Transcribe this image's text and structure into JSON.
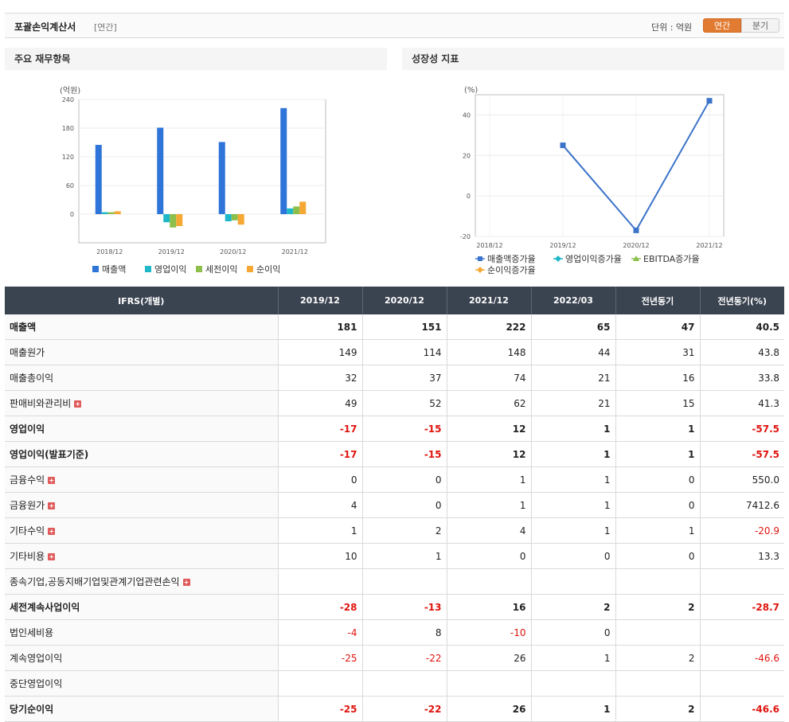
{
  "header": {
    "title": "포괄손익계산서",
    "period_type": "[연간]",
    "unit_label": "단위 : 억원",
    "toggle_annual": "연간",
    "toggle_quarter": "분기"
  },
  "panels": {
    "left_title": "주요 재무항목",
    "right_title": "성장성 지표"
  },
  "chart_data": [
    {
      "type": "bar",
      "ylabel": "(억원)",
      "categories": [
        "2018/12",
        "2019/12",
        "2020/12",
        "2021/12"
      ],
      "yticks": [
        "240",
        "180",
        "120",
        "60",
        "0"
      ],
      "ylim": [
        -60,
        240
      ],
      "grid": true,
      "legend_position": "bottom",
      "series": [
        {
          "name": "매출액",
          "color": "#2f74d8",
          "values": [
            145,
            181,
            151,
            222
          ]
        },
        {
          "name": "영업이익",
          "color": "#1fb8c9",
          "values": [
            4,
            -17,
            -15,
            12
          ]
        },
        {
          "name": "세전이익",
          "color": "#8cbf4b",
          "values": [
            4,
            -28,
            -13,
            16
          ]
        },
        {
          "name": "순이익",
          "color": "#f5a833",
          "values": [
            6,
            -25,
            -22,
            26
          ]
        }
      ]
    },
    {
      "type": "line",
      "ylabel": "(%)",
      "categories": [
        "2018/12",
        "2019/12",
        "2020/12",
        "2021/12"
      ],
      "yticks": [
        "40",
        "20",
        "0",
        "-20"
      ],
      "ylim": [
        -20,
        50
      ],
      "grid": true,
      "legend_position": "bottom",
      "series": [
        {
          "name": "매출액증가율",
          "color": "#3b74c9",
          "values": [
            null,
            25,
            -17,
            47
          ]
        }
      ],
      "legend": [
        {
          "name": "매출액증가율",
          "color": "#3b74c9",
          "marker": "square"
        },
        {
          "name": "영업이익증가율",
          "color": "#1fb8c9",
          "marker": "diamond"
        },
        {
          "name": "EBITDA증가율",
          "color": "#8cbf4b",
          "marker": "triangle"
        },
        {
          "name": "순이익증가율",
          "color": "#f5a833",
          "marker": "diamond"
        }
      ]
    }
  ],
  "table": {
    "columns": [
      "IFRS(개별)",
      "2019/12",
      "2020/12",
      "2021/12",
      "2022/03",
      "전년동기",
      "전년동기(%)"
    ],
    "rows": [
      {
        "label": "매출액",
        "bold": true,
        "plus": false,
        "cells": [
          "181",
          "151",
          "222",
          "65",
          "47",
          "40.5"
        ],
        "neg": [
          false,
          false,
          false,
          false,
          false,
          false
        ]
      },
      {
        "label": "매출원가",
        "bold": false,
        "plus": false,
        "cells": [
          "149",
          "114",
          "148",
          "44",
          "31",
          "43.8"
        ],
        "neg": [
          false,
          false,
          false,
          false,
          false,
          false
        ]
      },
      {
        "label": "매출총이익",
        "bold": false,
        "plus": false,
        "cells": [
          "32",
          "37",
          "74",
          "21",
          "16",
          "33.8"
        ],
        "neg": [
          false,
          false,
          false,
          false,
          false,
          false
        ]
      },
      {
        "label": "판매비와관리비",
        "bold": false,
        "plus": true,
        "cells": [
          "49",
          "52",
          "62",
          "21",
          "15",
          "41.3"
        ],
        "neg": [
          false,
          false,
          false,
          false,
          false,
          false
        ]
      },
      {
        "label": "영업이익",
        "bold": true,
        "plus": false,
        "cells": [
          "-17",
          "-15",
          "12",
          "1",
          "1",
          "-57.5"
        ],
        "neg": [
          true,
          true,
          false,
          false,
          false,
          true
        ]
      },
      {
        "label": "영업이익(발표기준)",
        "bold": true,
        "plus": false,
        "cells": [
          "-17",
          "-15",
          "12",
          "1",
          "1",
          "-57.5"
        ],
        "neg": [
          true,
          true,
          false,
          false,
          false,
          true
        ]
      },
      {
        "label": "금융수익",
        "bold": false,
        "plus": true,
        "cells": [
          "0",
          "0",
          "1",
          "1",
          "0",
          "550.0"
        ],
        "neg": [
          false,
          false,
          false,
          false,
          false,
          false
        ]
      },
      {
        "label": "금융원가",
        "bold": false,
        "plus": true,
        "cells": [
          "4",
          "0",
          "1",
          "1",
          "0",
          "7412.6"
        ],
        "neg": [
          false,
          false,
          false,
          false,
          false,
          false
        ]
      },
      {
        "label": "기타수익",
        "bold": false,
        "plus": true,
        "cells": [
          "1",
          "2",
          "4",
          "1",
          "1",
          "-20.9"
        ],
        "neg": [
          false,
          false,
          false,
          false,
          false,
          true
        ]
      },
      {
        "label": "기타비용",
        "bold": false,
        "plus": true,
        "cells": [
          "10",
          "1",
          "0",
          "0",
          "0",
          "13.3"
        ],
        "neg": [
          false,
          false,
          false,
          false,
          false,
          false
        ]
      },
      {
        "label": "종속기업,공동지배기업및관계기업관련손익",
        "bold": false,
        "plus": true,
        "cells": [
          "",
          "",
          "",
          "",
          "",
          ""
        ],
        "neg": [
          false,
          false,
          false,
          false,
          false,
          false
        ]
      },
      {
        "label": "세전계속사업이익",
        "bold": true,
        "plus": false,
        "cells": [
          "-28",
          "-13",
          "16",
          "2",
          "2",
          "-28.7"
        ],
        "neg": [
          true,
          true,
          false,
          false,
          false,
          true
        ]
      },
      {
        "label": "법인세비용",
        "bold": false,
        "plus": false,
        "cells": [
          "-4",
          "8",
          "-10",
          "0",
          "",
          ""
        ],
        "neg": [
          true,
          false,
          true,
          false,
          false,
          false
        ]
      },
      {
        "label": "계속영업이익",
        "bold": false,
        "plus": false,
        "cells": [
          "-25",
          "-22",
          "26",
          "1",
          "2",
          "-46.6"
        ],
        "neg": [
          true,
          true,
          false,
          false,
          false,
          true
        ]
      },
      {
        "label": "중단영업이익",
        "bold": false,
        "plus": false,
        "cells": [
          "",
          "",
          "",
          "",
          "",
          ""
        ],
        "neg": [
          false,
          false,
          false,
          false,
          false,
          false
        ]
      },
      {
        "label": "당기순이익",
        "bold": true,
        "plus": false,
        "cells": [
          "-25",
          "-22",
          "26",
          "1",
          "2",
          "-46.6"
        ],
        "neg": [
          true,
          true,
          false,
          false,
          false,
          true
        ]
      }
    ]
  }
}
